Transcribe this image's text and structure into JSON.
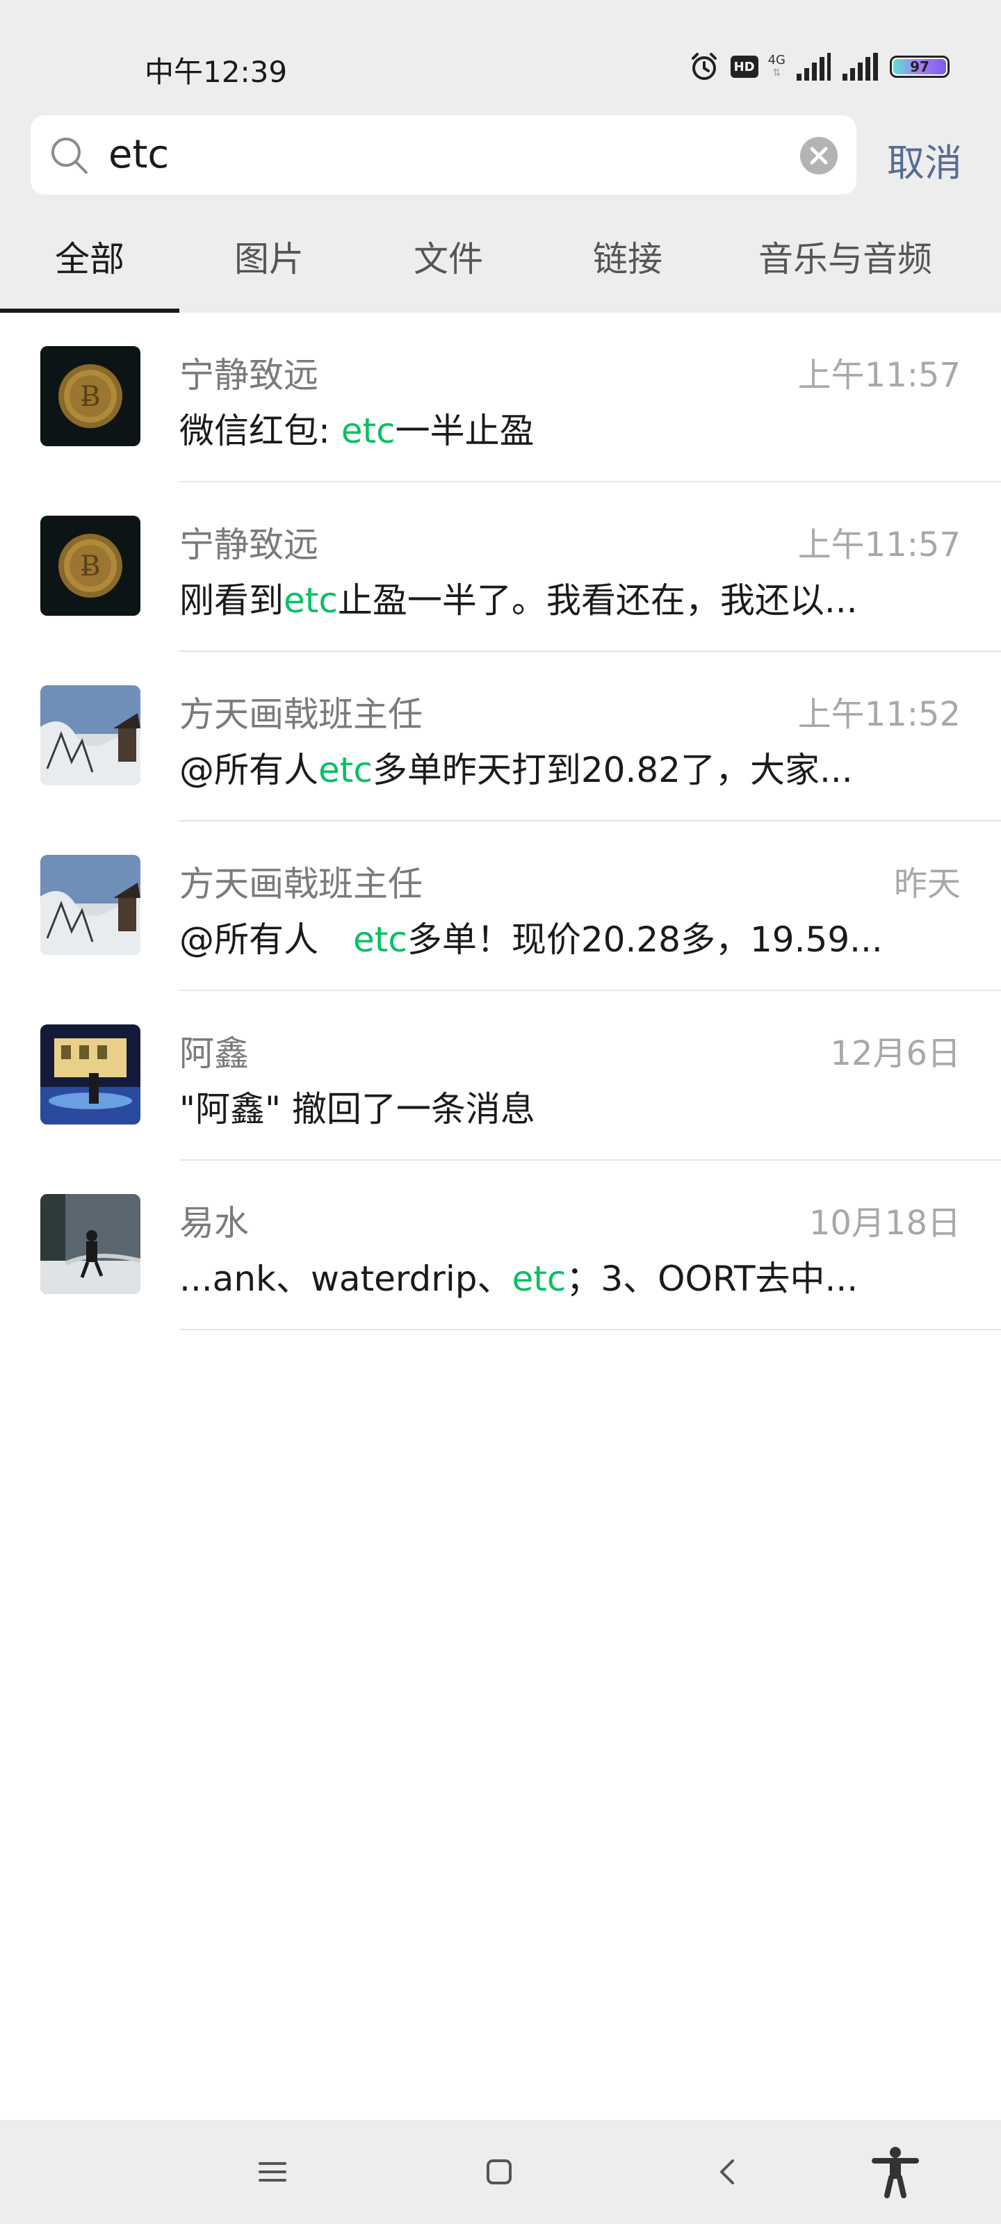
{
  "status_bar": {
    "time": "中午12:39",
    "hd": "HD",
    "network": "4G",
    "battery": "97",
    "icons": [
      "alarm-icon",
      "hd-icon",
      "signal-icon",
      "signal-icon",
      "battery-icon"
    ]
  },
  "search": {
    "query": "etc",
    "cancel_label": "取消",
    "icons": [
      "search-icon",
      "clear-icon"
    ]
  },
  "tabs": [
    {
      "label": "全部",
      "active": true
    },
    {
      "label": "图片",
      "active": false
    },
    {
      "label": "文件",
      "active": false
    },
    {
      "label": "链接",
      "active": false
    },
    {
      "label": "音乐与音频",
      "active": false
    }
  ],
  "results": [
    {
      "name": "宁静致远",
      "time": "上午11:57",
      "msg_before": "微信红包: ",
      "msg_hl": "etc",
      "msg_after": "一半止盈"
    },
    {
      "name": "宁静致远",
      "time": "上午11:57",
      "msg_before": "刚看到",
      "msg_hl": "etc",
      "msg_after": "止盈一半了。我看还在，我还以..."
    },
    {
      "name": "方天画戟班主任",
      "time": "上午11:52",
      "msg_before": "@所有人",
      "msg_hl": "etc",
      "msg_after": "多单昨天打到20.82了，大家..."
    },
    {
      "name": "方天画戟班主任",
      "time": "昨天",
      "msg_before": "@所有人　",
      "msg_hl": "etc",
      "msg_after": "多单！现价20.28多，19.59..."
    },
    {
      "name": "阿鑫",
      "time": "12月6日",
      "msg_before": "\"阿鑫\" 撤回了一条消息",
      "msg_hl": "",
      "msg_after": ""
    },
    {
      "name": "易水",
      "time": "10月18日",
      "msg_before": "...ank、waterdrip、",
      "msg_hl": "etc",
      "msg_after": "；3、OORT去中..."
    }
  ],
  "colors": {
    "highlight": "#07c160",
    "cancel": "#576b95",
    "background_gray": "#ededed"
  },
  "nav_bar": {
    "icons": [
      "menu-icon",
      "home-icon",
      "back-icon",
      "accessibility-icon"
    ]
  }
}
